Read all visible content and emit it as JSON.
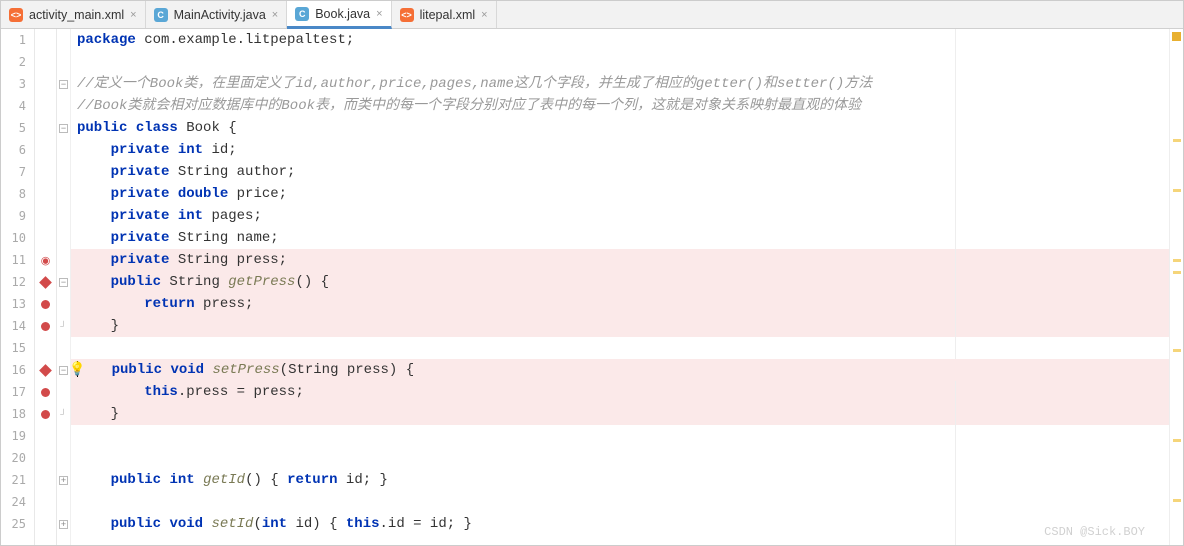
{
  "tabs": [
    {
      "icon": "xml",
      "iconText": "<>",
      "label": "activity_main.xml",
      "active": false
    },
    {
      "icon": "java",
      "iconText": "C",
      "label": "MainActivity.java",
      "active": false
    },
    {
      "icon": "java",
      "iconText": "C",
      "label": "Book.java",
      "active": true
    },
    {
      "icon": "xml",
      "iconText": "<>",
      "label": "litepal.xml",
      "active": false
    }
  ],
  "lines": {
    "l1": {
      "n": "1"
    },
    "l2": {
      "n": "2"
    },
    "l3": {
      "n": "3",
      "comment": "//定义一个Book类，在里面定义了id,author,price,pages,name这几个字段，并生成了相应的getter()和setter()方法"
    },
    "l4": {
      "n": "4",
      "comment": "//Book类就会相对应数据库中的Book表，而类中的每一个字段分别对应了表中的每一个列，这就是对象关系映射最直观的体验"
    },
    "l5": {
      "n": "5"
    },
    "l6": {
      "n": "6"
    },
    "l7": {
      "n": "7"
    },
    "l8": {
      "n": "8"
    },
    "l9": {
      "n": "9"
    },
    "l10": {
      "n": "10"
    },
    "l11": {
      "n": "11"
    },
    "l12": {
      "n": "12"
    },
    "l13": {
      "n": "13"
    },
    "l14": {
      "n": "14"
    },
    "l15": {
      "n": "15"
    },
    "l16": {
      "n": "16"
    },
    "l17": {
      "n": "17"
    },
    "l18": {
      "n": "18"
    },
    "l19": {
      "n": "19"
    },
    "l20": {
      "n": "20"
    },
    "l21": {
      "n": "21"
    },
    "l24": {
      "n": "24"
    },
    "l25": {
      "n": "25"
    }
  },
  "code": {
    "pkg_kw": "package",
    "pkg_name": " com.example.litpepaltest;",
    "public": "public",
    "class": "class",
    "book": " Book {",
    "private": "private",
    "int": "int",
    "id": " id;",
    "string": " String",
    "author": " author;",
    "double": "double",
    "price": " price;",
    "pages": " pages;",
    "name": " name;",
    "press": " press;",
    "getPress": "getPress",
    "sig1": "() {",
    "ret": "return",
    "pressVar": " press;",
    "brace": "}",
    "void": "void",
    "setPress": "setPress",
    "sig2": "(String press) {",
    "this": "this",
    "assign": ".press = press;",
    "getId": "getId",
    "sig3": "() { ",
    "idVar": " id; ",
    "brace2": "}",
    "setId": "setId",
    "sig4": "(",
    "sig5": " id) { ",
    "assign2": ".id = id; "
  },
  "watermark": "CSDN @Sick.BOY"
}
